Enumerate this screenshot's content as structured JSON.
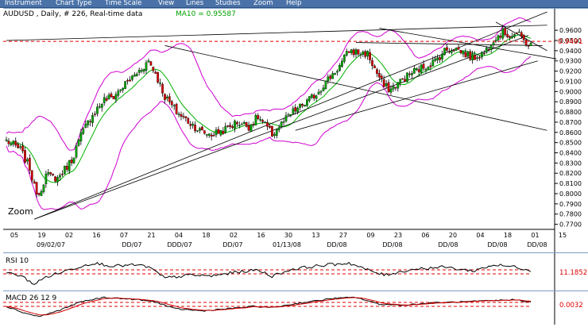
{
  "menu": [
    "Instrument",
    "Chart Type",
    "Time Scale",
    "View",
    "Lines",
    "Studies",
    "Zoom",
    "Help"
  ],
  "main": {
    "header": "AUDUSD , Daily, # 226, Real-time data",
    "ma_label": "MA10 = 0.95587",
    "zoom_label": "Zoom",
    "price_marker": "0.9491",
    "price_marker_value": 0.9491,
    "y_ticks": [
      "0.9600",
      "0.9500",
      "0.9400",
      "0.9300",
      "0.9200",
      "0.9100",
      "0.9000",
      "0.8900",
      "0.8800",
      "0.8700",
      "0.8600",
      "0.8500",
      "0.8400",
      "0.8300",
      "0.8200",
      "0.8100",
      "0.8000",
      "0.7900",
      "0.7800",
      "0.7700"
    ],
    "x_days": [
      "05",
      "19",
      "02",
      "16",
      "07",
      "21",
      "04",
      "18",
      "02",
      "16",
      "30",
      "13",
      "27",
      "09",
      "23",
      "06",
      "20",
      "04",
      "18",
      "01",
      "15"
    ],
    "x_months": [
      "09/02/07",
      "DD/07",
      "DDD/07",
      "DD/07",
      "01/13/08",
      "DD/08",
      "DD/08",
      "DD/08",
      "DD/08",
      "DD/08"
    ]
  },
  "rsi": {
    "label": "RSI 10",
    "value": "11.1852"
  },
  "macd": {
    "label": "MACD 26 12 9",
    "value": "0.0032"
  },
  "colors": {
    "menubar": "#4a72a8",
    "up": "#00a000",
    "down": "#d00000",
    "band": "#d000d0",
    "ma": "#00b000",
    "marker": "#e00000"
  },
  "chart_data": [
    {
      "type": "candlestick",
      "title": "AUDUSD , Daily, # 226, Real-time data",
      "ylim": [
        0.765,
        0.971
      ],
      "y_ticks": [
        0.96,
        0.95,
        0.94,
        0.93,
        0.92,
        0.91,
        0.9,
        0.89,
        0.88,
        0.87,
        0.86,
        0.85,
        0.84,
        0.83,
        0.82,
        0.81,
        0.8,
        0.79,
        0.78,
        0.77
      ],
      "anchors": [
        [
          0,
          0.852
        ],
        [
          6,
          0.843
        ],
        [
          10,
          0.825
        ],
        [
          12,
          0.806
        ],
        [
          14,
          0.8
        ],
        [
          17,
          0.818
        ],
        [
          22,
          0.815
        ],
        [
          28,
          0.833
        ],
        [
          32,
          0.857
        ],
        [
          37,
          0.878
        ],
        [
          42,
          0.892
        ],
        [
          46,
          0.895
        ],
        [
          50,
          0.905
        ],
        [
          56,
          0.918
        ],
        [
          61,
          0.93
        ],
        [
          64,
          0.918
        ],
        [
          68,
          0.895
        ],
        [
          73,
          0.88
        ],
        [
          79,
          0.869
        ],
        [
          84,
          0.86
        ],
        [
          88,
          0.858
        ],
        [
          94,
          0.863
        ],
        [
          99,
          0.87
        ],
        [
          104,
          0.866
        ],
        [
          108,
          0.875
        ],
        [
          111,
          0.867
        ],
        [
          114,
          0.858
        ],
        [
          118,
          0.868
        ],
        [
          123,
          0.88
        ],
        [
          128,
          0.888
        ],
        [
          133,
          0.898
        ],
        [
          138,
          0.912
        ],
        [
          143,
          0.925
        ],
        [
          147,
          0.94
        ],
        [
          151,
          0.938
        ],
        [
          155,
          0.937
        ],
        [
          158,
          0.922
        ],
        [
          162,
          0.905
        ],
        [
          165,
          0.902
        ],
        [
          170,
          0.912
        ],
        [
          175,
          0.92
        ],
        [
          180,
          0.925
        ],
        [
          184,
          0.93
        ],
        [
          188,
          0.94
        ],
        [
          192,
          0.943
        ],
        [
          196,
          0.938
        ],
        [
          200,
          0.933
        ],
        [
          205,
          0.938
        ],
        [
          209,
          0.952
        ],
        [
          213,
          0.958
        ],
        [
          216,
          0.955
        ],
        [
          219,
          0.957
        ],
        [
          222,
          0.95
        ],
        [
          225,
          0.945
        ]
      ],
      "rsi_anchors": [
        [
          0,
          50
        ],
        [
          6,
          45
        ],
        [
          12,
          28
        ],
        [
          17,
          42
        ],
        [
          28,
          58
        ],
        [
          37,
          70
        ],
        [
          46,
          64
        ],
        [
          56,
          66
        ],
        [
          61,
          62
        ],
        [
          68,
          40
        ],
        [
          79,
          46
        ],
        [
          88,
          44
        ],
        [
          99,
          52
        ],
        [
          108,
          56
        ],
        [
          114,
          44
        ],
        [
          123,
          58
        ],
        [
          133,
          64
        ],
        [
          147,
          70
        ],
        [
          155,
          56
        ],
        [
          162,
          46
        ],
        [
          175,
          58
        ],
        [
          188,
          62
        ],
        [
          200,
          54
        ],
        [
          209,
          66
        ],
        [
          219,
          62
        ],
        [
          225,
          55
        ]
      ],
      "macd_anchors": [
        [
          0,
          0.0
        ],
        [
          8,
          -0.006
        ],
        [
          14,
          -0.009
        ],
        [
          22,
          -0.004
        ],
        [
          32,
          0.004
        ],
        [
          42,
          0.008
        ],
        [
          56,
          0.006
        ],
        [
          64,
          0.004
        ],
        [
          72,
          -0.002
        ],
        [
          84,
          -0.004
        ],
        [
          96,
          -0.002
        ],
        [
          106,
          0.0
        ],
        [
          114,
          -0.001
        ],
        [
          126,
          0.003
        ],
        [
          140,
          0.007
        ],
        [
          150,
          0.008
        ],
        [
          160,
          0.002
        ],
        [
          170,
          0.001
        ],
        [
          182,
          0.003
        ],
        [
          196,
          0.004
        ],
        [
          208,
          0.005
        ],
        [
          218,
          0.006
        ],
        [
          225,
          0.004
        ]
      ]
    }
  ]
}
